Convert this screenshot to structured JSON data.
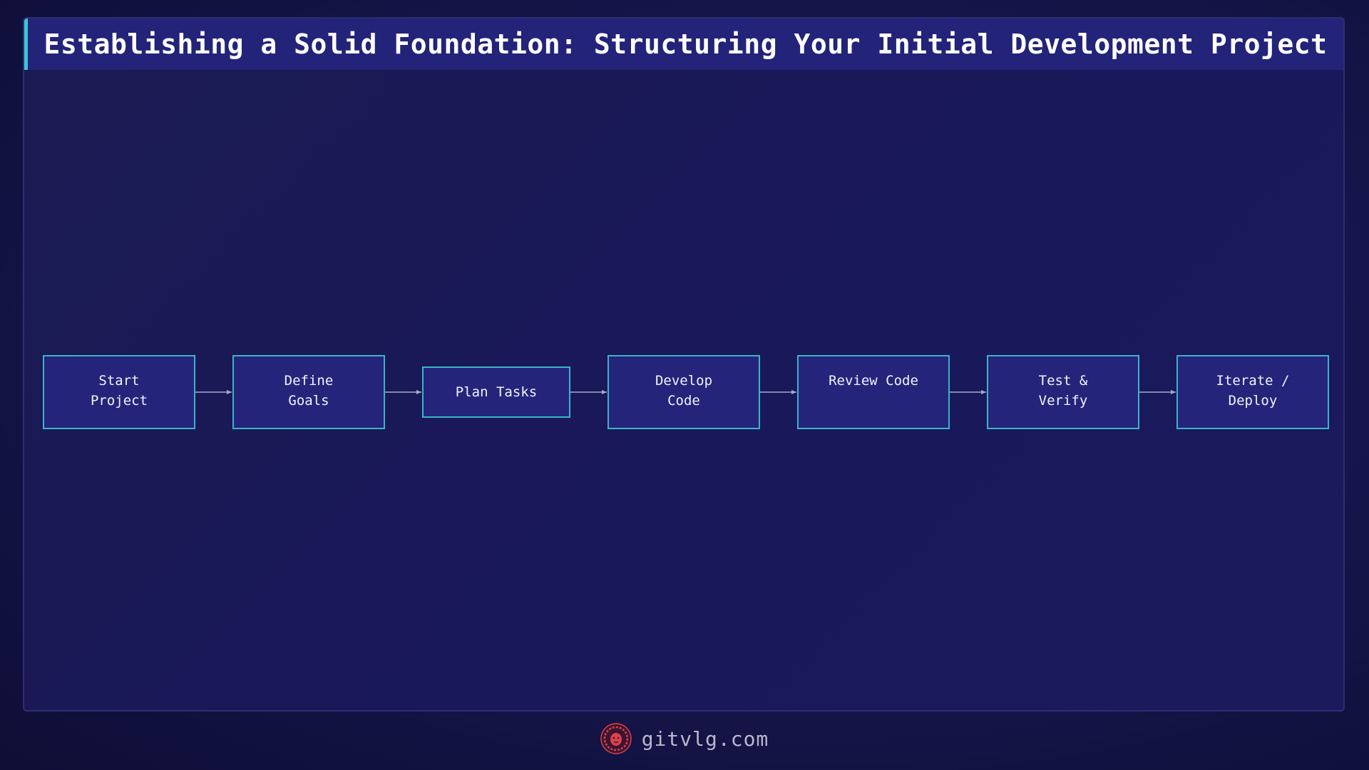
{
  "title": "Establishing a Solid Foundation: Structuring Your Initial Development Project",
  "colors": {
    "node_fill": "#24247a",
    "node_border": "#3ab4c8",
    "arrow": "#a8a8d0",
    "accent": "#38c8d6",
    "logo": "#e0404a"
  },
  "flow": {
    "nodes": [
      {
        "id": "start",
        "label": "Start\nProject"
      },
      {
        "id": "define",
        "label": "Define\nGoals"
      },
      {
        "id": "plan",
        "label": "Plan Tasks"
      },
      {
        "id": "develop",
        "label": "Develop\nCode"
      },
      {
        "id": "review",
        "label": "Review Code"
      },
      {
        "id": "test",
        "label": "Test &\nVerify"
      },
      {
        "id": "iterate",
        "label": "Iterate /\nDeploy"
      }
    ],
    "edges": [
      {
        "from": "start",
        "to": "define"
      },
      {
        "from": "define",
        "to": "plan"
      },
      {
        "from": "plan",
        "to": "develop"
      },
      {
        "from": "develop",
        "to": "review"
      },
      {
        "from": "review",
        "to": "test"
      },
      {
        "from": "test",
        "to": "iterate"
      }
    ]
  },
  "footer": {
    "logo_icon": "lion-logo-icon",
    "site": "gitvlg.com"
  }
}
